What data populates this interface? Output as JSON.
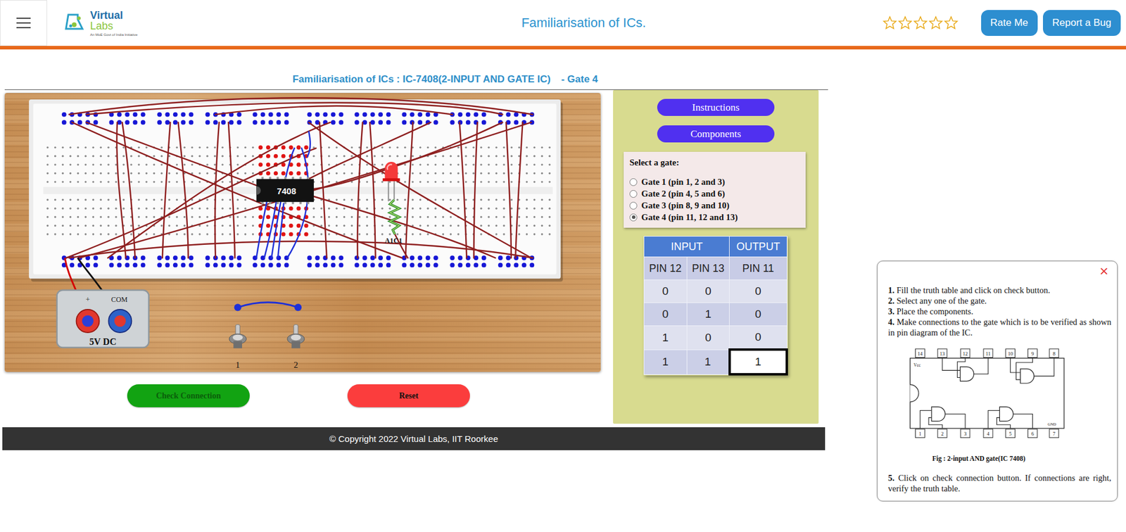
{
  "header": {
    "logo": {
      "name_1": "Virtual",
      "name_2": "Labs",
      "tagline": "An MoE Govt of India Initiative"
    },
    "title": "Familiarisation of ICs.",
    "rating": {
      "stars": 0,
      "total": 5
    },
    "buttons": [
      "Rate Me",
      "Report a Bug"
    ]
  },
  "heading": {
    "title": "Familiarisation of ICs : IC-7408(2-INPUT AND GATE IC)",
    "gate": "- Gate 4"
  },
  "board": {
    "ic_label": "7408",
    "led_label": "A1C1",
    "power": {
      "plus": "+",
      "com": "COM",
      "label": "5V DC"
    },
    "switches": [
      {
        "label": "1"
      },
      {
        "label": "2"
      }
    ]
  },
  "actions": [
    {
      "label": "Check Connection",
      "color": "#12a312"
    },
    {
      "label": "Reset",
      "color": "#fb3d3d"
    }
  ],
  "side_panel": {
    "buttons": [
      "Instructions",
      "Components"
    ],
    "gate_select": {
      "title": "Select a gate:",
      "options": [
        {
          "label": "Gate 1 (pin 1, 2 and 3)",
          "selected": false
        },
        {
          "label": "Gate 2 (pin 4, 5 and 6)",
          "selected": false
        },
        {
          "label": "Gate 3 (pin 8, 9 and 10)",
          "selected": false
        },
        {
          "label": "Gate 4 (pin 11, 12 and 13)",
          "selected": true
        }
      ]
    },
    "truth_table": {
      "groups": [
        "INPUT",
        "OUTPUT"
      ],
      "columns": [
        "PIN 12",
        "PIN 13",
        "PIN 11"
      ],
      "rows": [
        {
          "cells": [
            "0",
            "0",
            "0"
          ],
          "focused": false
        },
        {
          "cells": [
            "0",
            "1",
            "0"
          ],
          "focused": false
        },
        {
          "cells": [
            "1",
            "0",
            "0"
          ],
          "focused": false
        },
        {
          "cells": [
            "1",
            "1",
            "1"
          ],
          "focused": true
        }
      ]
    }
  },
  "footer": "© Copyright 2022 Virtual Labs, IIT Roorkee",
  "popup": {
    "close": "×",
    "steps": [
      {
        "num": "1.",
        "text": "Fill the truth table and click on check button."
      },
      {
        "num": "2.",
        "text": "Select any one of the gate."
      },
      {
        "num": "3.",
        "text": "Place the components."
      },
      {
        "num": "4.",
        "text": "Make connections to the gate which is to be verified as shown in pin diagram of the IC."
      }
    ],
    "figure": {
      "top_pins": [
        "14",
        "13",
        "12",
        "11",
        "10",
        "9",
        "8"
      ],
      "bottom_pins": [
        "1",
        "2",
        "3",
        "4",
        "5",
        "6",
        "7"
      ],
      "vcc": "Vcc",
      "gnd": "GND",
      "caption": "Fig  : 2-input AND gate(IC 7408)"
    },
    "last_step": {
      "num": "5.",
      "text": "Click on check connection button. If connections are right, verify the truth table."
    }
  }
}
